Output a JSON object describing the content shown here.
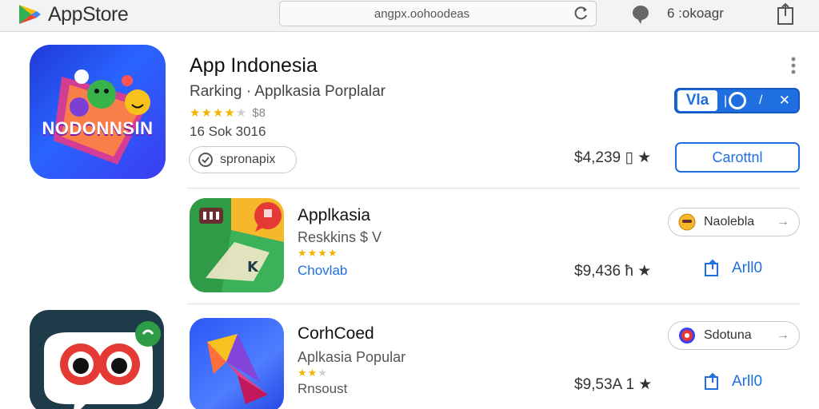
{
  "header": {
    "brand": "AppStore",
    "url": "angpx.oohoodeas",
    "user_label": "6 :okoagr"
  },
  "apps": [
    {
      "title": "App Indonesia",
      "subtitle": "Rarking · Applkasia Porplalar",
      "stars_filled": "★★★★",
      "stars_empty": "★",
      "rating_count": "$8",
      "meta": "16 Sok 3016",
      "icon_text": "NODONNSIN",
      "chip_label": "spronapix",
      "toggle_label": "Vla",
      "price": "$4,239 ▯ ★",
      "cta_label": "Carottnl",
      "icon_colors": {
        "primary": "#1f3ad8",
        "accent": "#ff6f3c"
      }
    },
    {
      "title": "Applkasia",
      "subtitle": "Reskkins $ V",
      "stars_filled": "★★★★",
      "stars_empty": "",
      "extra": "Chovlab",
      "price": "$9,436 ћ ★",
      "chip_label": "Naolebla",
      "action_label": "Arll0",
      "icon_colors": {
        "primary": "#f5b82a",
        "accent": "#2e9b46"
      }
    },
    {
      "title": "CorhCoed",
      "subtitle": "Aplkasia Popular",
      "stars_filled": "★★",
      "stars_empty": "★",
      "extra": "Rnsoust",
      "price": "$9,53A 1 ★",
      "chip_label": "Sdotuna",
      "action_label": "Arll0",
      "icon_colors": {
        "primary": "#2a58f5",
        "accent": "#e0428a"
      }
    }
  ],
  "colors": {
    "accent_blue": "#1f6fe0",
    "star_gold": "#f3b400",
    "topbar_bg": "#f3f3f3"
  }
}
